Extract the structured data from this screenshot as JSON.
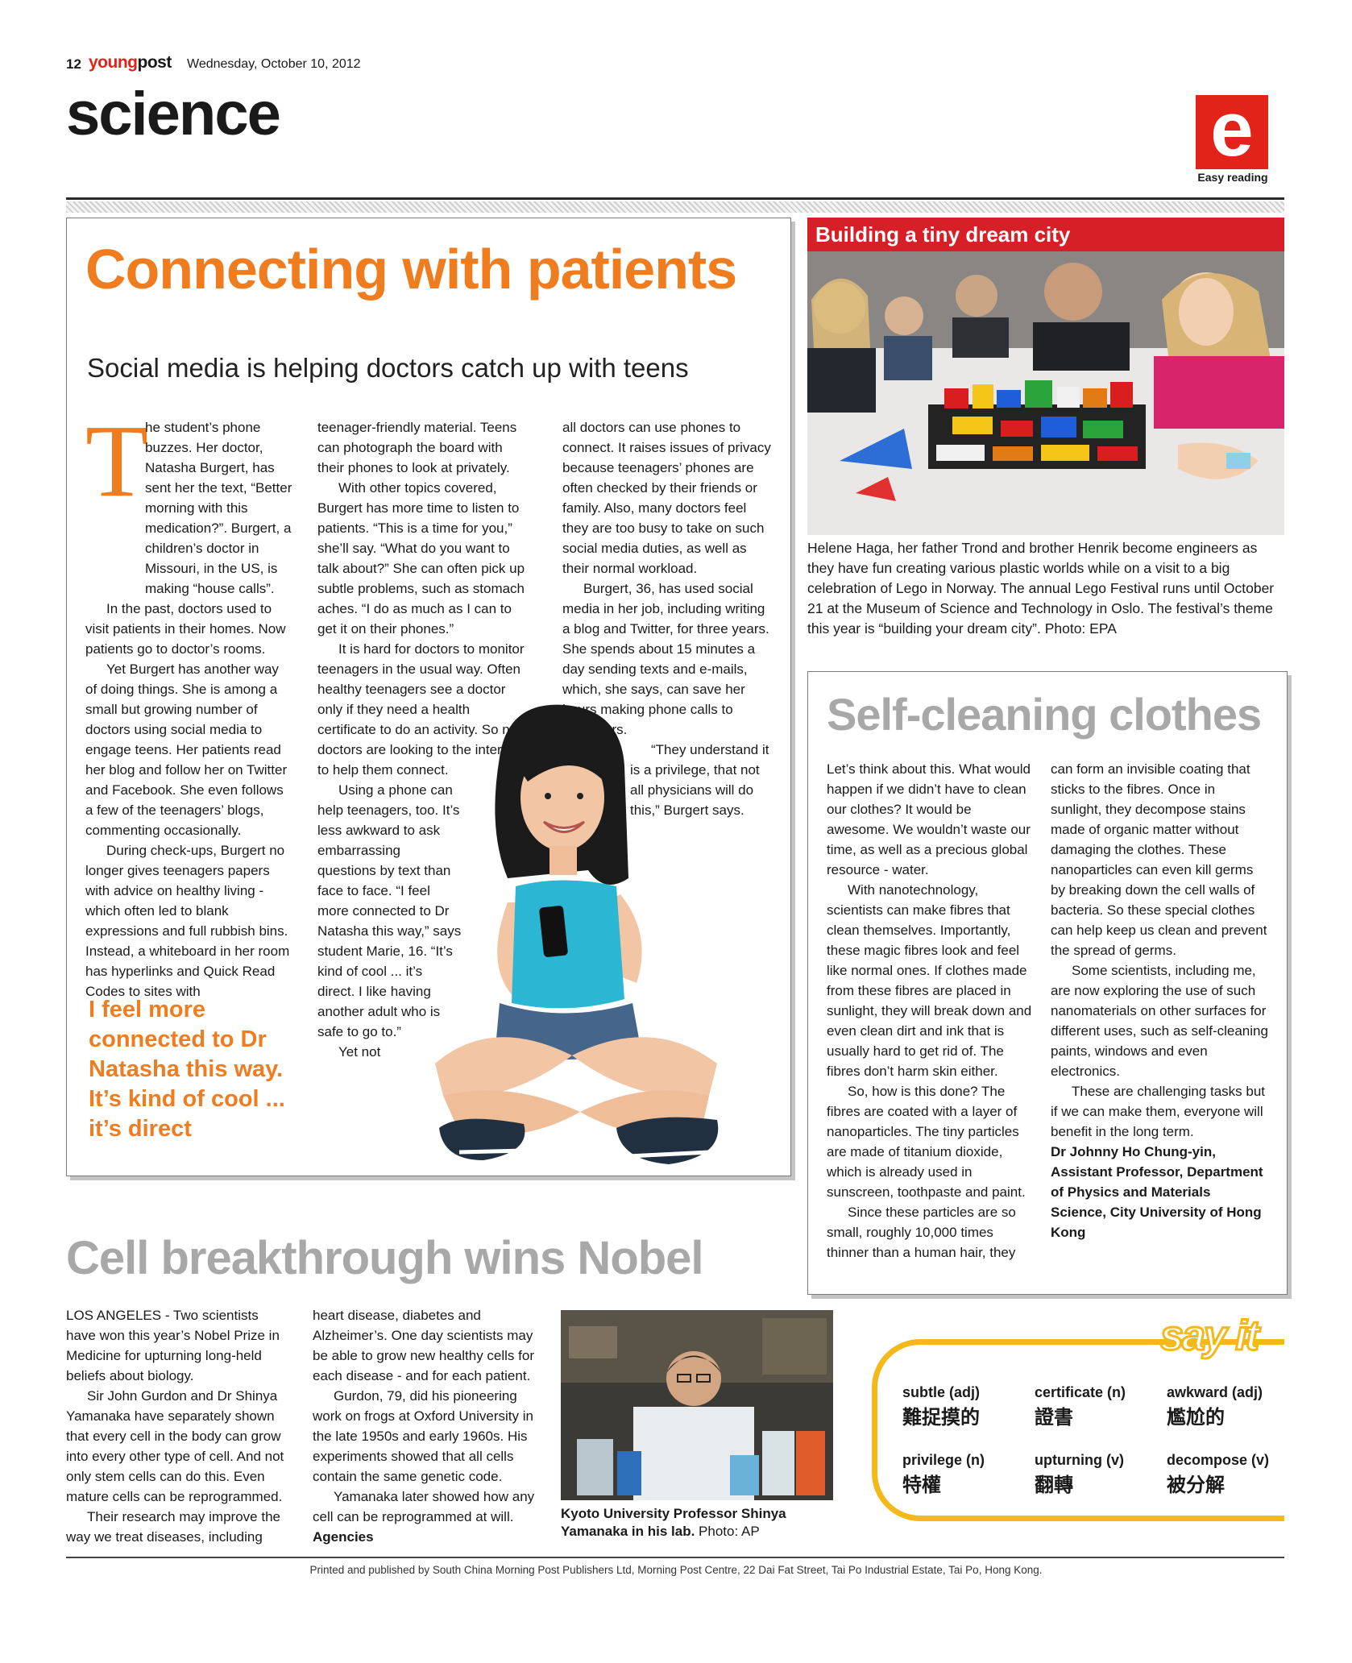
{
  "header": {
    "page_number": "12",
    "brand_young": "young",
    "brand_post": "post",
    "date": "Wednesday, October 10, 2012",
    "section": "science",
    "easy_logo": "e",
    "easy_label": "Easy reading"
  },
  "main": {
    "headline": "Connecting with patients",
    "subhead": "Social media is helping doctors catch up with teens",
    "drop_cap": "T",
    "col1": [
      "he student’s phone buzzes. Her doctor, Natasha Burgert, has sent her the text, “Better morning with this medication?”. Burgert, a children’s doctor in Missouri, in the US, is making “house calls”.",
      "In the past, doctors used to visit patients in their homes. Now patients go to doctor’s rooms.",
      "Yet Burgert has another way of doing things. She is among a small but growing number of doctors using social media to engage teens. Her patients read her blog and follow her on Twitter and Facebook. She even follows a few of the teenagers’ blogs, commenting occasionally.",
      "During check-ups, Burgert no longer gives teenagers papers with advice on healthy living - which often led to blank expressions and full rubbish bins. Instead, a whiteboard in her room has hyperlinks and Quick Read Codes to sites with"
    ],
    "col2": [
      "teenager-friendly material. Teens can photograph the board with their phones to look at privately.",
      "With other topics covered, Burgert has more time to listen to patients. “This is a time for you,” she’ll say. “What do you want to talk about?” She can often pick up subtle problems, such as stomach aches. “I do as much as I can to get it on their phones.”",
      "It is hard for doctors to monitor teenagers in the usual way. Often healthy teenagers see a doctor only if they need a health certificate to do an activity. So now doctors are looking to the internet to help them connect.",
      "Using a phone can help teenagers, too. It’s less awkward to ask embarrassing questions by text than face to face. “I feel more connected to Dr Natasha this way,” says student Marie, 16. “It’s kind of cool ... it’s direct. I like having another adult who is safe to go to.”",
      "Yet not"
    ],
    "col3": [
      "all doctors can use phones to connect. It raises issues of privacy because teenagers’ phones are often checked by their friends or family. Also, many doctors feel they are too busy to take on such social media duties, as well as their normal workload.",
      "Burgert, 36, has used social media in her job, including writing a blog and Twitter, for three years. She spends about 15 minutes a day sending texts and e-mails, which, she says, can save her hours making phone calls to teenagers.",
      "“They understand it is a privilege, that not all physicians will do this,” Burgert says."
    ],
    "pull_quote": "I feel more connected to Dr Natasha this way. It’s kind of cool ... it’s direct"
  },
  "lego": {
    "bar_title": "Building a tiny dream city",
    "caption": "Helene Haga, her father Trond and brother Henrik become engineers as they have fun creating various plastic worlds while on a visit to a big celebration of Lego in Norway. The annual Lego Festival runs until October 21 at the Museum of Science and Technology in Oslo. The festival’s theme this year is “building your dream city”.",
    "credit": "Photo: EPA"
  },
  "clean": {
    "headline": "Self-cleaning clothes",
    "col1": [
      "Let’s think about this. What would happen if we didn’t have to clean our clothes? It would be awesome. We wouldn’t waste our time, as well as a precious global resource - water.",
      "With nanotechnology, scientists can make fibres that clean themselves. Importantly, these magic fibres look and feel like normal ones. If clothes made from these fibres are placed in sunlight, they will break down and even clean dirt and ink that is usually hard to get rid of. The fibres don’t harm skin either.",
      "So, how is this done? The fibres are coated with a layer of nanoparticles. The tiny particles are made of titanium dioxide, which is already used in sunscreen, toothpaste and paint.",
      "Since these particles are so small, roughly 10,000 times thinner than a human hair, they"
    ],
    "col2": [
      "can form an invisible coating that sticks to the fibres. Once in sunlight, they decompose stains made of organic matter without damaging the clothes. These nanoparticles can even kill germs by breaking down the cell walls of bacteria. So these special clothes can help keep us clean and prevent the spread of germs.",
      "Some scientists, including me, are now exploring the use of such nanomaterials on other surfaces for different uses, such as self-cleaning paints, windows and even electronics.",
      "These are challenging tasks but if we can make them, everyone will benefit in the long term."
    ],
    "byline": "Dr Johnny Ho Chung-yin, Assistant Professor, Department of Physics and Materials Science, City University of Hong Kong"
  },
  "cell": {
    "headline": "Cell breakthrough wins Nobel",
    "col1": [
      "LOS ANGELES - Two scientists have won this year’s Nobel Prize in Medicine for upturning long-held beliefs about biology.",
      "Sir John Gurdon and Dr Shinya Yamanaka have separately shown that every cell in the body can grow into every other type of cell. And not only stem cells can do this. Even mature cells can be reprogrammed.",
      "Their research may improve the way we treat diseases, including"
    ],
    "col2": [
      "heart disease, diabetes and Alzheimer’s. One day scientists may be able to grow new healthy cells for each disease - and for each patient.",
      "Gurdon, 79, did his pioneering work on frogs at Oxford University in the late 1950s and early 1960s. His experiments showed that all cells contain the same genetic code.",
      "Yamanaka later showed how any cell can be reprogrammed at will."
    ],
    "agency": "Agencies",
    "caption": "Kyoto University Professor Shinya Yamanaka in his lab.",
    "credit": "Photo: AP"
  },
  "sayit": {
    "logo": "say it",
    "words": [
      {
        "en": "subtle (adj)",
        "zh": "難捉摸的"
      },
      {
        "en": "certificate (n)",
        "zh": "證書"
      },
      {
        "en": "awkward (adj)",
        "zh": "尷尬的"
      },
      {
        "en": "privilege (n)",
        "zh": "特權"
      },
      {
        "en": "upturning (v)",
        "zh": "翻轉"
      },
      {
        "en": "decompose (v)",
        "zh": "被分解"
      }
    ]
  },
  "footer": "Printed and published by South China Morning Post Publishers Ltd, Morning Post Centre, 22 Dai Fat Street, Tai Po Industrial Estate, Tai Po, Hong Kong.",
  "colors": {
    "accent_orange": "#f07c20",
    "red": "#e2231a",
    "grey_head": "#a8a8a8",
    "yellow": "#f3b81a"
  }
}
